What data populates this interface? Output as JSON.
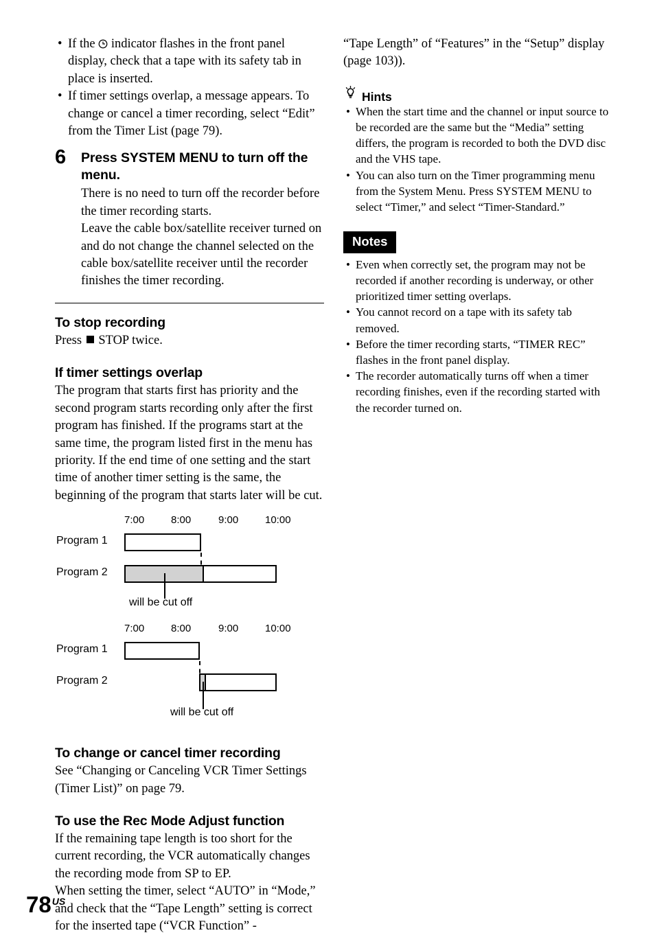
{
  "page": {
    "number": "78",
    "region_suffix": "US"
  },
  "left_column": {
    "top_bullets": [
      "If the ⊕ indicator flashes in the front panel display, check that a tape with its safety tab in place is inserted.",
      "If timer settings overlap, a message appears. To change or cancel a timer recording, select “Edit” from the Timer List (page 79)."
    ],
    "top_bullet_1_pre": "If the ",
    "top_bullet_1_post": " indicator flashes in the front panel display, check that a tape with its safety tab in place is inserted.",
    "step": {
      "number": "6",
      "title": "Press SYSTEM MENU to turn off the menu.",
      "body": "There is no need to turn off the recorder before the timer recording starts.\nLeave the cable box/satellite receiver turned on and do not change the channel selected on the cable box/satellite receiver until the recorder finishes the timer recording."
    },
    "stop_recording": {
      "heading": "To stop recording",
      "body_pre": "Press ",
      "body_post": " STOP twice."
    },
    "overlap": {
      "heading": "If timer settings overlap",
      "body": "The program that starts first has priority and the second program starts recording only after the first program has finished. If the programs start at the same time, the program listed first in the menu has priority. If the end time of one setting and the start time of another timer setting is the same, the beginning of the program that starts later will be cut."
    },
    "change_cancel": {
      "heading": "To change or cancel timer recording",
      "body": "See “Changing or Canceling VCR Timer Settings (Timer List)” on page 79."
    },
    "rec_mode": {
      "heading": "To use the Rec Mode Adjust function",
      "body": "If the remaining tape length is too short for the current recording, the VCR automatically changes the recording mode from SP to EP.\nWhen setting the timer, select “AUTO” in “Mode,” and check that the “Tape Length” setting is correct for the inserted tape (“VCR Function” -"
    }
  },
  "right_column": {
    "continuation": "“Tape Length” of “Features” in the “Setup” display (page 103)).",
    "hints": {
      "label": "Hints",
      "items": [
        "When the start time and the channel or input source to be recorded are the same but the “Media” setting differs, the program is recorded to both the DVD disc and the VHS tape.",
        "You can also turn on the Timer programming menu from the System Menu. Press SYSTEM MENU to select “Timer,” and select “Timer-Standard.”"
      ]
    },
    "notes": {
      "label": "Notes",
      "items": [
        "Even when correctly set, the program may not be recorded if another recording is underway, or other prioritized timer setting overlaps.",
        "You cannot record on a tape with its safety tab removed.",
        "Before the timer recording starts, “TIMER REC” flashes in the front panel display.",
        "The recorder automatically turns off when a timer recording finishes, even if the recording started with the recorder turned on."
      ]
    }
  },
  "chart_data": [
    {
      "type": "bar",
      "title": "Timer overlap — case 1: second program start is cut",
      "xlabel": "",
      "ylabel": "",
      "axis_ticks": [
        "7:00",
        "8:00",
        "9:00",
        "10:00"
      ],
      "xlim": [
        "7:00",
        "10:00"
      ],
      "categories": [
        "Program 1",
        "Program 2"
      ],
      "series": [
        {
          "name": "Program 1",
          "start": "7:00",
          "end": "8:38",
          "cut_start": null,
          "cut_end": null
        },
        {
          "name": "Program 2",
          "start": "7:00",
          "end": "10:15",
          "cut_start": "7:00",
          "cut_end": "8:40"
        }
      ],
      "annotation": "will be cut off",
      "legend": "none",
      "grid": false
    },
    {
      "type": "bar",
      "title": "Timer overlap — case 2: end time equals next start time",
      "xlabel": "",
      "ylabel": "",
      "axis_ticks": [
        "7:00",
        "8:00",
        "9:00",
        "10:00"
      ],
      "xlim": [
        "7:00",
        "10:00"
      ],
      "categories": [
        "Program 1",
        "Program 2"
      ],
      "series": [
        {
          "name": "Program 1",
          "start": "7:00",
          "end": "8:36",
          "cut_start": null,
          "cut_end": null
        },
        {
          "name": "Program 2",
          "start": "8:36",
          "end": "10:15",
          "cut_start": "8:36",
          "cut_end": "8:41"
        }
      ],
      "annotation": "will be cut off",
      "legend": "none",
      "grid": false
    }
  ],
  "diagram_labels": {
    "program_1": "Program 1",
    "program_2": "Program 2",
    "cut_caption": "will be cut off",
    "tick_7": "7:00",
    "tick_8": "8:00",
    "tick_9": "9:00",
    "tick_10": "10:00"
  }
}
